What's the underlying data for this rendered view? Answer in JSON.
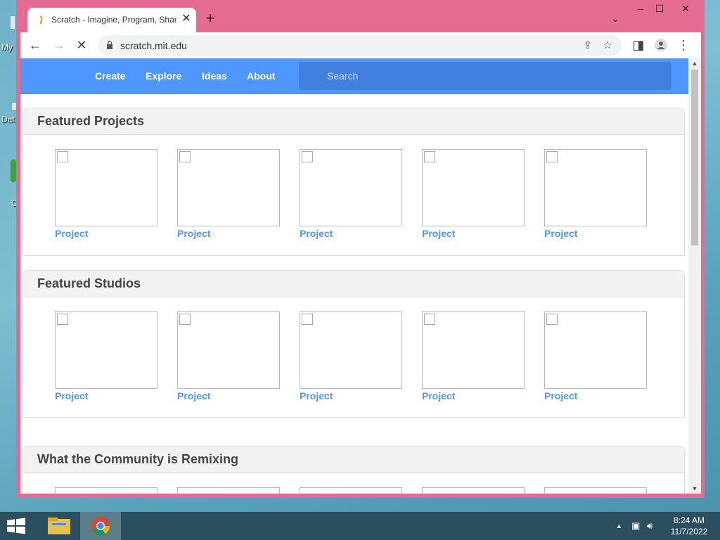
{
  "desktop": {
    "icons": [
      {
        "label": "My",
        "icon": "computer-icon"
      },
      {
        "label": "Dat",
        "icon": "database-icon"
      },
      {
        "label": "C",
        "icon": "chrome-icon"
      }
    ]
  },
  "browser": {
    "tab_title": "Scratch - Imagine, Program, Shar",
    "url": "scratch.mit.edu",
    "icons": {
      "back": "back-arrow-icon",
      "forward": "forward-arrow-icon",
      "stop": "stop-loading-icon",
      "lock": "lock-icon",
      "share": "share-icon",
      "star": "bookmark-star-icon",
      "sidepanel": "side-panel-icon",
      "profile": "profile-icon",
      "menu": "kebab-menu-icon"
    }
  },
  "scratch": {
    "nav": {
      "links": [
        "Create",
        "Explore",
        "Ideas",
        "About"
      ],
      "search_placeholder": "Search"
    },
    "sections": [
      {
        "title": "Featured Projects",
        "items": [
          "Project",
          "Project",
          "Project",
          "Project",
          "Project"
        ]
      },
      {
        "title": "Featured Studios",
        "items": [
          "Project",
          "Project",
          "Project",
          "Project",
          "Project"
        ]
      },
      {
        "title": "What the Community is Remixing",
        "items": []
      }
    ]
  },
  "taskbar": {
    "time": "8:24 AM",
    "date": "11/7/2022"
  },
  "colors": {
    "scratch_blue": "#4d97ff",
    "browser_frame": "#e66b92",
    "taskbar": "#2c4f5f"
  }
}
